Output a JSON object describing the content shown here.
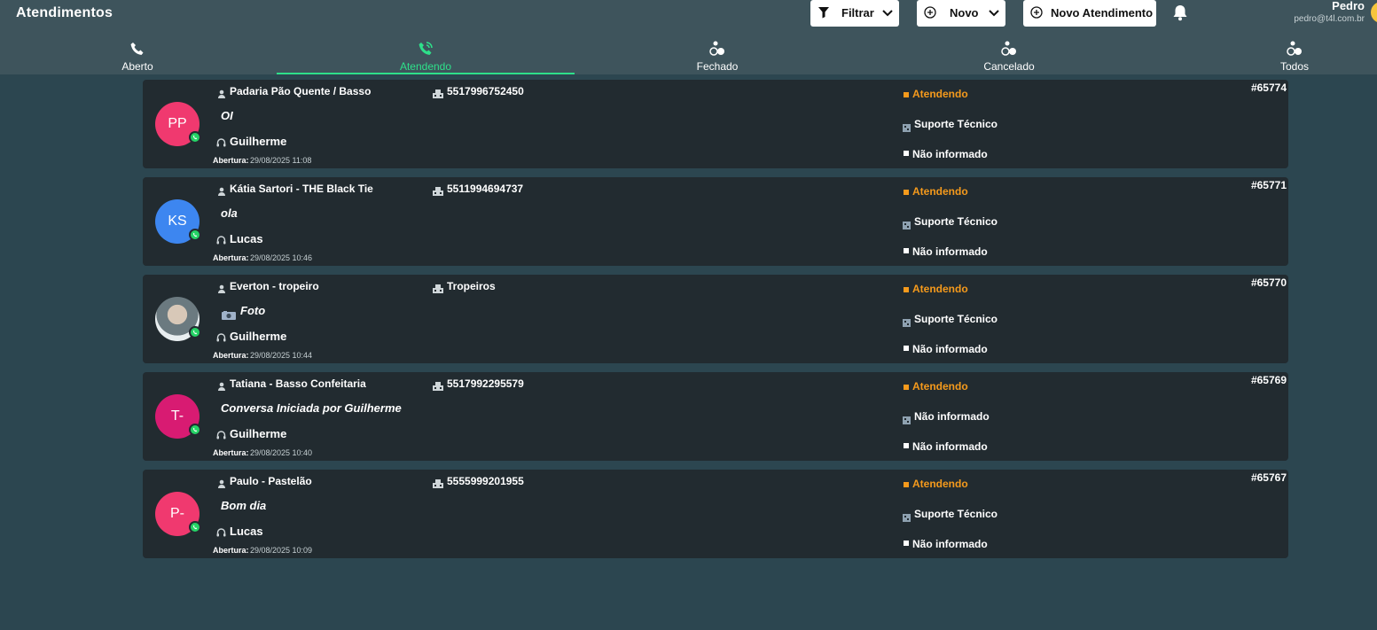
{
  "header": {
    "title": "Atendimentos",
    "filter_label": "Filtrar",
    "new_label": "Novo",
    "new_ticket_label": "Novo Atendimento",
    "user_name": "Pedro",
    "user_email": "pedro@t4l.com.br"
  },
  "tabs": [
    {
      "label": "Aberto",
      "icon": "phone-icon"
    },
    {
      "label": "Atendendo",
      "icon": "phone-ring-icon",
      "active": true
    },
    {
      "label": "Fechado",
      "icon": "closed-status-icon"
    },
    {
      "label": "Cancelado",
      "icon": "cancelled-status-icon"
    },
    {
      "label": "Todos",
      "icon": "all-status-icon"
    }
  ],
  "cards": [
    {
      "initials": "PP",
      "avatar_color": "#f0396f",
      "contact": "Padaria Pão Quente / Basso",
      "phone": "5517996752450",
      "message": "OI",
      "agent": "Guilherme",
      "opening_label": "Abertura:",
      "opening": "29/08/2025 11:08",
      "status": "Atendendo",
      "department": "Suporte Técnico",
      "info": "Não informado",
      "ticket": "#65774"
    },
    {
      "initials": "KS",
      "avatar_color": "#3d86f0",
      "contact": "Kátia Sartori - THE Black Tie",
      "phone": "5511994694737",
      "message": "ola",
      "agent": "Lucas",
      "opening_label": "Abertura:",
      "opening": "29/08/2025 10:46",
      "status": "Atendendo",
      "department": "Suporte Técnico",
      "info": "Não informado",
      "ticket": "#65771"
    },
    {
      "initials": "",
      "avatar_color": "#6b7a80",
      "contact": "Everton - tropeiro",
      "phone": "Tropeiros",
      "message": "Foto",
      "agent": "Guilherme",
      "opening_label": "Abertura:",
      "opening": "29/08/2025 10:44",
      "status": "Atendendo",
      "department": "Suporte Técnico",
      "info": "Não informado",
      "ticket": "#65770"
    },
    {
      "initials": "T-",
      "avatar_color": "#d81b72",
      "contact": "Tatiana - Basso Confeitaria",
      "phone": "5517992295579",
      "message": "Conversa Iniciada por Guilherme",
      "agent": "Guilherme",
      "opening_label": "Abertura:",
      "opening": "29/08/2025 10:40",
      "status": "Atendendo",
      "department": "Não informado",
      "info": "Não informado",
      "ticket": "#65769"
    },
    {
      "initials": "P-",
      "avatar_color": "#f0396f",
      "contact": "Paulo - Pastelão",
      "phone": "5555999201955",
      "message": "Bom dia",
      "agent": "Lucas",
      "opening_label": "Abertura:",
      "opening": "29/08/2025 10:09",
      "status": "Atendendo",
      "department": "Suporte Técnico",
      "info": "Não informado",
      "ticket": "#65767"
    }
  ],
  "colors": {
    "accent": "#2ee08a",
    "status": "#f59a1c",
    "header": "#3e545c",
    "background": "#2c4650",
    "card": "#222b30"
  }
}
